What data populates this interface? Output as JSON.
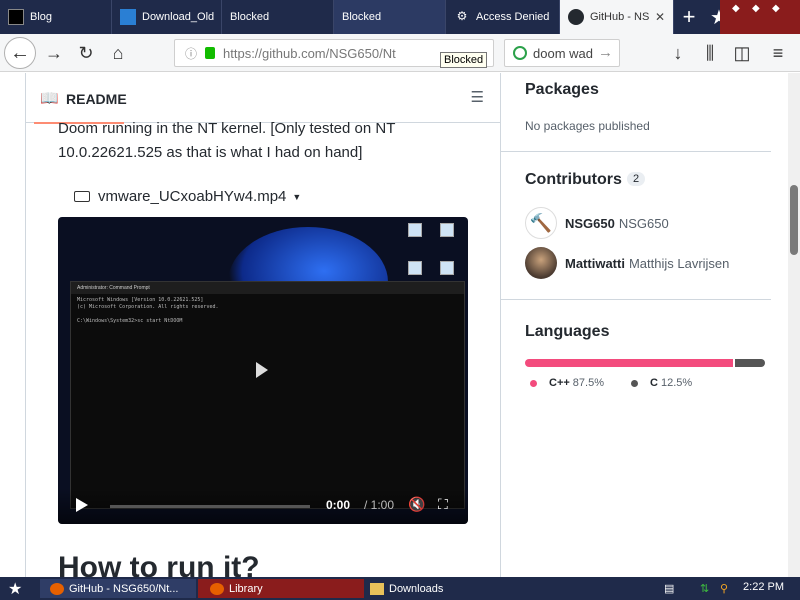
{
  "tabs": [
    {
      "label": "Blog",
      "icon": "blog-icon"
    },
    {
      "label": "Download_Old",
      "icon": "download-icon"
    },
    {
      "label": "Blocked",
      "icon": "blocked-icon"
    },
    {
      "label": "Blocked",
      "icon": "blocked-icon"
    },
    {
      "label": "Access Denied",
      "icon": "shield-icon"
    },
    {
      "label": "GitHub - NS",
      "icon": "github-icon",
      "active": true
    }
  ],
  "navbar": {
    "url": "https://github.com/NSG650/Nt",
    "search_value": "doom wad",
    "tooltip": "Blocked"
  },
  "readme": {
    "header": "README",
    "text": "Doom running in the NT kernel. [Only tested on NT 10.0.22621.525 as that is what I had on hand]",
    "video_file": "vmware_UCxoabHYw4.mp4",
    "video_time": "0:00",
    "video_duration": "/ 1:00",
    "cmd_title": "Administrator: Command Prompt",
    "cmd_lines": [
      "Microsoft Windows [Version 10.0.22621.525]",
      "(c) Microsoft Corporation. All rights reserved.",
      "C:\\Windows\\System32>sc start NtDOOM"
    ],
    "next_heading": "How to run it?"
  },
  "sidebar": {
    "packages_title": "Packages",
    "packages_sub": "No packages published",
    "contributors_title": "Contributors",
    "contributors_count": "2",
    "contributors": [
      {
        "login": "NSG650",
        "name": "NSG650"
      },
      {
        "login": "Mattiwatti",
        "name": "Matthijs Lavrijsen"
      }
    ],
    "languages_title": "Languages",
    "languages": [
      {
        "name": "C++",
        "percent": "87.5%",
        "value": 87.5,
        "color": "#f34b7d"
      },
      {
        "name": "C",
        "percent": "12.5%",
        "value": 12.5,
        "color": "#555555"
      }
    ]
  },
  "taskbar": {
    "items": [
      "GitHub - NSG650/Nt...",
      "Library",
      "Downloads"
    ],
    "clock": "2:22 PM"
  }
}
